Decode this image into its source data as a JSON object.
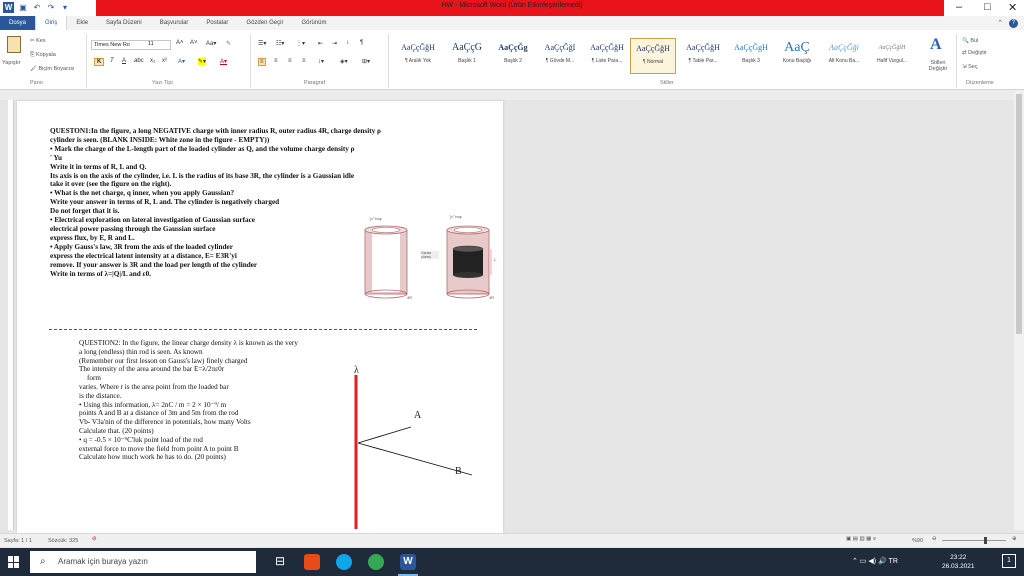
{
  "window": {
    "title": "HW - Microsoft Word (Ürün Etkinleştirilemedi)",
    "controls": {
      "minimize": "–",
      "restore": "□",
      "close": "✕"
    }
  },
  "tabs": [
    "Dosya",
    "Giriş",
    "Ekle",
    "Sayfa Düzeni",
    "Başvurular",
    "Postalar",
    "Gözden Geçir",
    "Görünüm"
  ],
  "ribbon": {
    "clipboard": {
      "paste": "Yapıştır",
      "cut": "Kes",
      "copy": "Kopyala",
      "format_painter": "Biçim Boyacısı",
      "label": "Pano"
    },
    "font": {
      "name": "Times New Ro",
      "size": "11",
      "label": "Yazı Tipi"
    },
    "paragraph": {
      "label": "Paragraf"
    },
    "styles": {
      "label": "Stiller",
      "items": [
        {
          "preview": "AaÇçĞğH",
          "name": "¶ Aralık Yok"
        },
        {
          "preview": "AaÇçG",
          "name": "Başlık 1"
        },
        {
          "preview": "AaÇçĞg",
          "name": "Başlık 2"
        },
        {
          "preview": "AaÇçĞğI",
          "name": "¶ Gövde M..."
        },
        {
          "preview": "AaÇçĞğH",
          "name": "¶ Liste Para..."
        },
        {
          "preview": "AaÇçĞğH",
          "name": "¶ Normal"
        },
        {
          "preview": "AaÇçĞğH",
          "name": "¶ Table Par..."
        },
        {
          "preview": "AaÇçĞgH",
          "name": "Başlık 3"
        },
        {
          "preview": "AaÇ",
          "name": "Konu Başlığı"
        },
        {
          "preview": "AaÇçĞği",
          "name": "Alt Konu Ba..."
        },
        {
          "preview": "AaÇçĞğlH",
          "name": "Hafif Vurgul..."
        }
      ],
      "change": "Stilleri Değiştir"
    },
    "editing": {
      "find": "Bul",
      "replace": "Değiştir",
      "select": "Seç",
      "label": "Düzenleme"
    }
  },
  "doc": {
    "q1": [
      "QUESTON1:In the figure, a long NEGATIVE charge with inner radius R, outer radius 4R, charge density ρ",
      "cylinder is seen. (BLANK INSIDE: White zone in the figure - EMPTY))",
      "• Mark the charge of the L-length part of the loaded cylinder as Q, and the volume charge density ρ",
      "' Yu",
      "Write it in terms of R, L and Q.",
      "Its axis is on the axis of the cylinder, i.e. L is the radius of its base 3R, the cylinder is a Gaussian idle",
      "take it over (see the figure on the right).",
      "• What is the net charge, q inner, when you apply Gaussian?",
      "Write your answer in terms of R, L and. The cylinder is negatively charged",
      "Do not forget that it is.",
      "• Electrical exploration on lateral investigation of Gaussian surface",
      "electrical power passing through the Gaussian surface",
      "express flux, by E, R and L.",
      "• Apply Gauss's law, 3R from the axis of the loaded cylinder",
      "express the electrical latent intensity at a distance, E= E3R'yi",
      "remove. If your answer is 3R and the load per length of the cylinder",
      "Write in terms of  λ=|Q|/L and ε0."
    ],
    "fig1": {
      "label_top": "\"ρ\" boş",
      "label_side": "4R"
    },
    "fig2": {
      "label_top": "\"ρ\" boş",
      "gauss": "Gauss yüzeyi",
      "label_L": "L",
      "label_side": "4R"
    },
    "q2": [
      "QUESTION2: In the figure, the linear charge density λ is known as the very",
      "a long (endless) thin rod is seen. As known",
      "(Remember our first lesson on Gauss's law) finely charged",
      "The intensity of the area around the bar E=λ/2πε0r",
      "form",
      "varies. Where r is the area point from the loaded bar",
      "is the distance.",
      "• Using this information, λ= 2nC / m = 2 × 10⁻⁹/ m",
      "points A and B at a distance of 3m and 5m from the rod",
      "Vb- V3a'nin of the difference in potentials, how many Volts",
      "Calculate that. (20 points)",
      "• q = -0.5 × 10⁻⁹C'luk point load of the rod",
      "external force to move the field from point A to point B",
      "Calculate how much work he has to do. (20 points)"
    ],
    "fig3": {
      "lambda": "λ",
      "A": "A",
      "B": "B"
    }
  },
  "status": {
    "page": "Sayfa: 1 / 1",
    "words": "Sözcük: 325",
    "zoom": "%90"
  },
  "taskbar": {
    "search_placeholder": "Aramak için buraya yazın",
    "time": "23:22",
    "date": "26.03.2021"
  },
  "colors": {
    "title_red": "#e8131b",
    "word_blue": "#2b579a",
    "rod_red": "#e02020"
  }
}
